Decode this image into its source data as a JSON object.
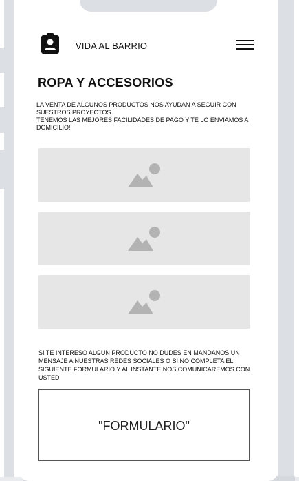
{
  "header": {
    "brand_name": "VIDA AL BARRIO",
    "app_icon": "clipboard-user-icon",
    "menu_icon": "hamburger-menu-icon"
  },
  "main": {
    "title": "ROPA Y ACCESORIOS",
    "intro_lines": [
      "LA VENTA DE ALGUNOS PRODUCTOS NOS AYUDAN A SEGUIR CON",
      "SUESTROS PROYECTOS.",
      "TENEMOS LAS MEJORES FACILIDADES DE PAGO Y TE LO ENVIAMOS A",
      "DOMICILIO!"
    ],
    "product_images": [
      {
        "icon": "image-placeholder-icon"
      },
      {
        "icon": "image-placeholder-icon"
      },
      {
        "icon": "image-placeholder-icon"
      }
    ],
    "contact_lines": [
      "SI TE INTERESO ALGUN PRODUCTO NO DUDES EN MANDANOS UN",
      "MENSAJE A NUESTRAS REDES SOCIALES O SI NO COMPLETA  EL",
      "SIGUIENTE FORMULARIO Y AL INSTANTE NOS COMUNICAREMOS CON",
      "USTED"
    ],
    "form_placeholder": "\"FORMULARIO\""
  },
  "colors": {
    "frame_gray": "#dcdfe3",
    "placeholder_bg": "#e6e6e6",
    "placeholder_icon": "#b3b3b3",
    "text": "#111111"
  }
}
